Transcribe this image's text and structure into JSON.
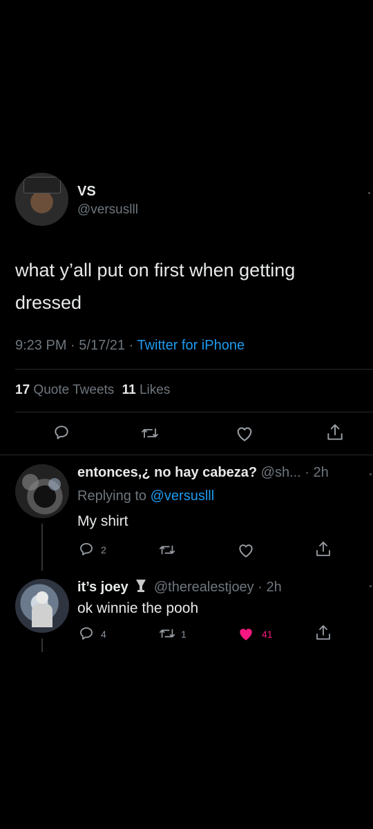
{
  "tweet": {
    "display_name": "VS",
    "handle": "@versuslll",
    "text_line1": "what y’all put on first when getting",
    "text_line2": "dressed",
    "time": "9:23 PM",
    "sep1": "·",
    "date": "5/17/21",
    "sep2": "·",
    "client": "Twitter for iPhone",
    "quote_count": "17",
    "quote_label": "Quote Tweets",
    "like_count": "11",
    "like_label": "Likes"
  },
  "replies": [
    {
      "display_name": "entonces,¿ no hay cabeza?",
      "handle_time": "@sh... · 2h",
      "replying_prefix": "Replying to",
      "replying_handle": "@versuslll",
      "text": "My shirt",
      "reply_count": "2",
      "retweet_count": "",
      "like_count": "",
      "liked": false
    },
    {
      "display_name": "it’s joey",
      "handle_time": "@therealestjoey · 2h",
      "text": "ok winnie the pooh",
      "reply_count": "4",
      "retweet_count": "1",
      "like_count": "41",
      "liked": true
    }
  ],
  "colors": {
    "background": "#000000",
    "link": "#1d9bf0",
    "like_active": "#f91880",
    "text": "#d9d9d9"
  }
}
